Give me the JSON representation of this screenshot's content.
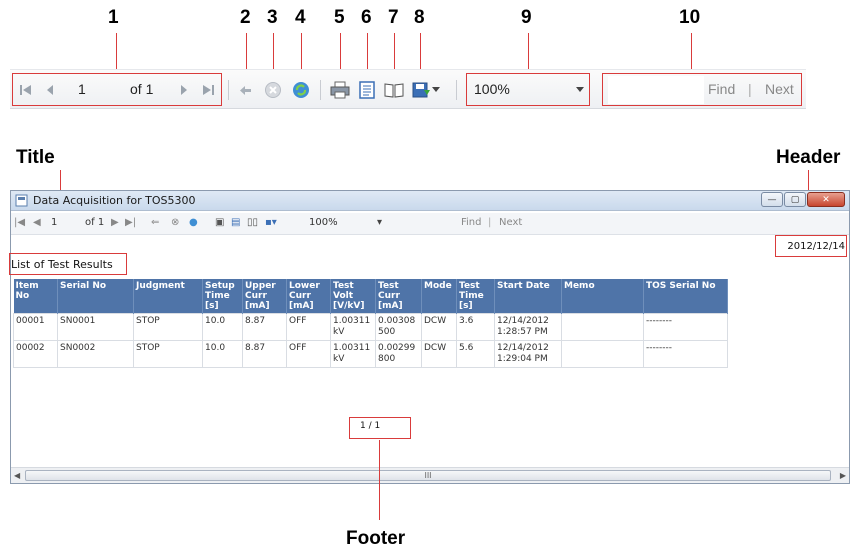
{
  "callouts": [
    "1",
    "2",
    "3",
    "4",
    "5",
    "6",
    "7",
    "8",
    "9",
    "10"
  ],
  "labels": {
    "title": "Title",
    "header": "Header",
    "footer": "Footer"
  },
  "toolbar": {
    "page_value": "1",
    "page_of": "of 1",
    "zoom": "100%",
    "find_label": "Find",
    "find_sep": "|",
    "next_label": "Next"
  },
  "window": {
    "title": "Data Acquisition for TOS5300",
    "small_toolbar": {
      "page_value": "1",
      "page_of": "of 1",
      "zoom": "100%",
      "find_label": "Find",
      "find_sep": "|",
      "next_label": "Next"
    },
    "header_date": "2012/12/14",
    "report_title": "List of Test Results",
    "footer_page": "1 / 1",
    "columns": [
      "Item No",
      "Serial No",
      "Judgment",
      "Setup Time [s]",
      "Upper Curr [mA]",
      "Lower Curr [mA]",
      "Test Volt [V/kV]",
      "Test Curr [mA]",
      "Mode",
      "Test Time [s]",
      "Start Date",
      "Memo",
      "TOS Serial No"
    ],
    "rows": [
      [
        "00001",
        "SN0001",
        "STOP",
        "10.0",
        "8.87",
        "OFF",
        "1.00311 kV",
        "0.00308 500",
        "DCW",
        "3.6",
        "12/14/2012 1:28:57 PM",
        "",
        "--------"
      ],
      [
        "00002",
        "SN0002",
        "STOP",
        "10.0",
        "8.87",
        "OFF",
        "1.00311 kV",
        "0.00299 800",
        "DCW",
        "5.6",
        "12/14/2012 1:29:04 PM",
        "",
        "--------"
      ]
    ],
    "scroll_grip": "III"
  },
  "icons": [
    "first-page-icon",
    "prev-page-icon",
    "next-page-icon",
    "last-page-icon",
    "back-icon",
    "stop-icon",
    "refresh-icon",
    "print-icon",
    "page-setup-icon",
    "print-layout-icon",
    "export-icon",
    "dropdown-caret-icon"
  ]
}
